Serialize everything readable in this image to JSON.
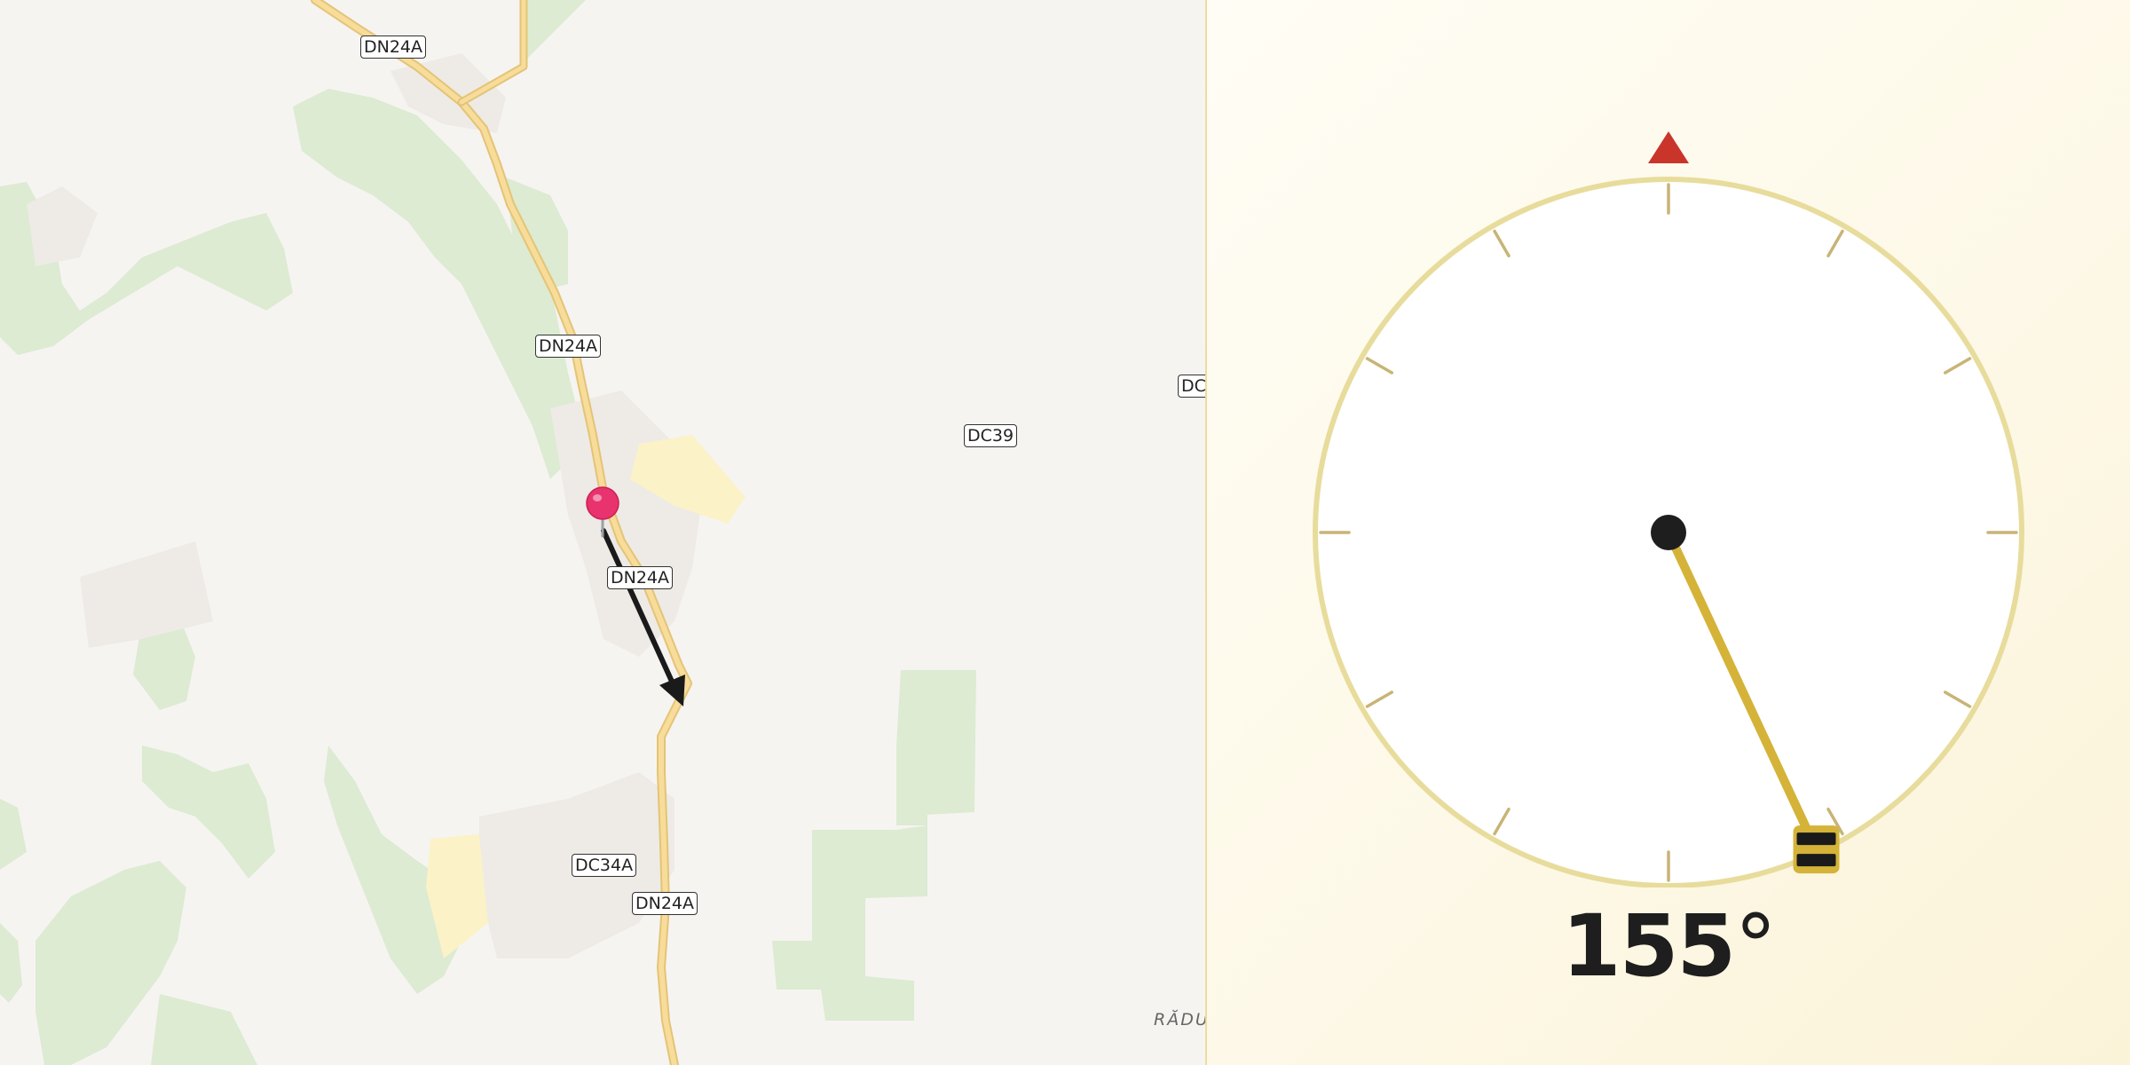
{
  "map": {
    "road_labels": [
      {
        "id": "dn24a-1",
        "text": "DN24A"
      },
      {
        "id": "dn24a-2",
        "text": "DN24A"
      },
      {
        "id": "dn24a-3",
        "text": "DN24A"
      },
      {
        "id": "dn24a-4",
        "text": "DN24A"
      },
      {
        "id": "dc39",
        "text": "DC39"
      },
      {
        "id": "dc34a",
        "text": "DC34A"
      },
      {
        "id": "dc-partial",
        "text": "DC"
      }
    ],
    "place_label": "RĂDU",
    "pin_color": "#e8336e",
    "arrow_color": "#1a1a1a",
    "road_color": "#f5d58e",
    "forest_color": "#dcebd2",
    "settlement_color": "#eeeae6"
  },
  "compass": {
    "heading_deg": 155,
    "heading_value": "155",
    "heading_unit": "°",
    "north_marker_color": "#c9352b",
    "ring_color": "#e8dc9c",
    "needle_color": "#d4b338"
  }
}
